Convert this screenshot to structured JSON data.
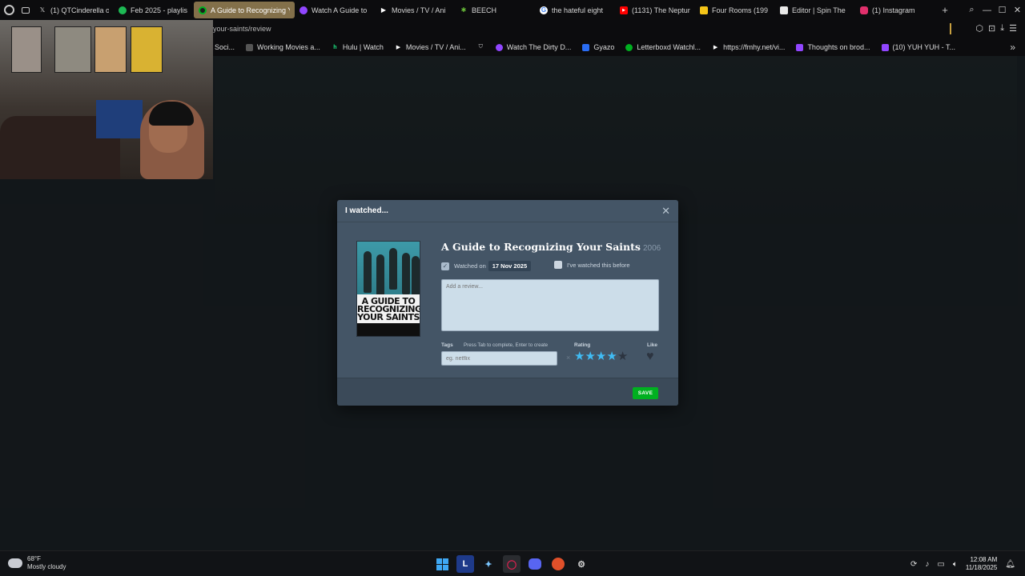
{
  "browser": {
    "tabs": [
      {
        "title": "(1) QTCinderella o",
        "favicon": "x-icon",
        "color": "#000000"
      },
      {
        "title": "Feb 2025 - playlis",
        "favicon": "spotify-icon",
        "color": "#1db954"
      },
      {
        "title": "A Guide to Recognizing Y",
        "favicon": "letterboxd-icon",
        "color": "#00b020",
        "active": true
      },
      {
        "title": "Watch A Guide to",
        "favicon": "twitch-like-icon",
        "color": "#9146ff"
      },
      {
        "title": "Movies / TV / Ani",
        "favicon": "play-icon",
        "color": "#ffffff"
      },
      {
        "title": "BEECH",
        "favicon": "alien-icon",
        "color": "#6abf3a"
      },
      {
        "title": "the hateful eight",
        "favicon": "google-icon",
        "color": "#4285f4"
      },
      {
        "title": "(1131) The Neptun",
        "favicon": "youtube-icon",
        "color": "#ff0000"
      },
      {
        "title": "Four Rooms (199",
        "favicon": "imdb-icon",
        "color": "#f5c518"
      },
      {
        "title": "Editor | Spin The",
        "favicon": "editor-icon",
        "color": "#e9e9e9"
      },
      {
        "title": "(1) Instagram",
        "favicon": "instagram-icon",
        "color": "#e1306c"
      }
    ],
    "url_fragment": "g-your-saints/review",
    "bookmarks": [
      {
        "label": "Soci...",
        "color": "#777777"
      },
      {
        "label": "Working Movies a...",
        "color": "#555555"
      },
      {
        "label": "Hulu | Watch",
        "color": "#1ce783",
        "glyph": "h"
      },
      {
        "label": "Movies / TV / Ani...",
        "color": "#ffffff"
      },
      {
        "label": "",
        "color": "#888888"
      },
      {
        "label": "Watch The Dirty D...",
        "color": "#9146ff"
      },
      {
        "label": "Gyazo",
        "color": "#2a6df4"
      },
      {
        "label": "Letterboxd Watchl...",
        "color": "#00b020"
      },
      {
        "label": "https://fmhy.net/vi...",
        "color": "#ffffff"
      },
      {
        "label": "Thoughts on brod...",
        "color": "#9146ff"
      },
      {
        "label": "(10) YUH YUH - T...",
        "color": "#9146ff"
      }
    ]
  },
  "modal": {
    "title": "I watched...",
    "film_title": "A Guide to Recognizing Your Saints",
    "film_year": "2006",
    "poster_text": "A GUIDE TO RECOGNIZING YOUR SAINTS",
    "watched_on_label": "Watched on",
    "watched_on_date": "17 Nov 2025",
    "watched_on_checked": true,
    "rewatch_label": "I've watched this before",
    "rewatch_checked": false,
    "review_placeholder": "Add a review...",
    "tags_label": "Tags",
    "tags_hint": "Press Tab to complete, Enter to create",
    "tags_placeholder": "eg. netflix",
    "rating_label": "Rating",
    "rating_value": 4,
    "rating_max": 5,
    "like_label": "Like",
    "liked": false,
    "save_label": "SAVE",
    "accent_star": "#40bcf4",
    "save_color": "#00b020"
  },
  "taskbar": {
    "temperature": "68°F",
    "condition": "Mostly cloudy",
    "time": "12:08 AM",
    "date": "11/18/2025"
  }
}
